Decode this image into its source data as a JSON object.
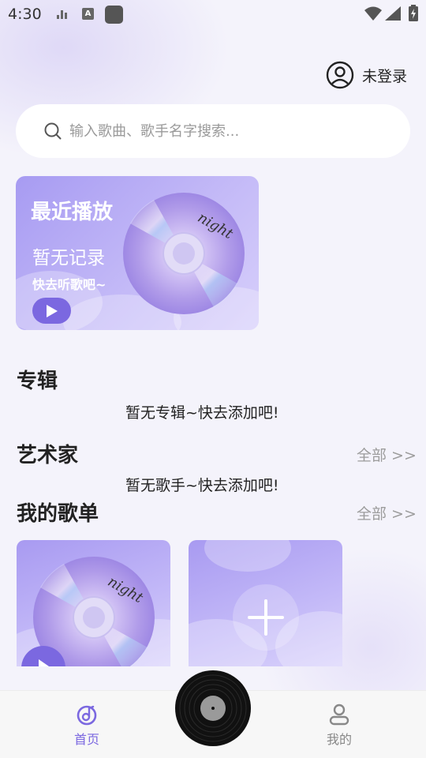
{
  "status_bar": {
    "time": "4:30",
    "status_icons": [
      "bars-icon",
      "a-icon",
      "app-square-icon",
      "wifi-icon",
      "signal-icon",
      "battery-charging-icon"
    ]
  },
  "header": {
    "login_label": "未登录",
    "icon": "user-circle-icon"
  },
  "search": {
    "placeholder": "输入歌曲、歌手名字搜索...",
    "value": "",
    "icon": "search-icon"
  },
  "recent": {
    "title": "最近播放",
    "empty_text": "暂无记录",
    "tip": "快去听歌吧~",
    "cd_label": "night"
  },
  "albums": {
    "title": "专辑",
    "empty_text": "暂无专辑~快去添加吧!"
  },
  "artists": {
    "title": "艺术家",
    "more_label": "全部 >>",
    "empty_text": "暂无歌手~快去添加吧!"
  },
  "playlists": {
    "title": "我的歌单",
    "more_label": "全部 >>",
    "cd_label": "night"
  },
  "bottom_nav": {
    "items": [
      {
        "label": "首页",
        "icon": "home-music-icon",
        "active": true
      },
      {
        "label": "我的",
        "icon": "profile-icon",
        "active": false
      }
    ]
  },
  "colors": {
    "accent": "#7b68e0",
    "card_gradient_start": "#a79bf2",
    "card_gradient_end": "#d7cffb",
    "muted_text": "#9c9c9c"
  }
}
